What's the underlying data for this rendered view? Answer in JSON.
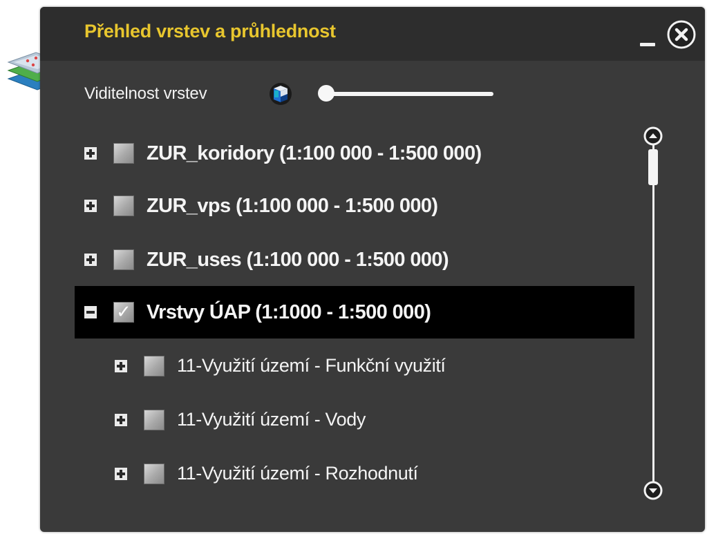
{
  "panel": {
    "title": "Přehled vrstev a průhlednost",
    "title_color": "#e8c62e",
    "minimize_icon": "minimize-icon",
    "close_icon": "close-icon"
  },
  "visibility": {
    "label": "Viditelnost vrstev",
    "opacity_icon": "opacity-cube-icon",
    "slider_value": 0
  },
  "tree": {
    "rows": [
      {
        "label": "ZUR_koridory (1:100 000 - 1:500 000)",
        "level": 0,
        "expanded": false,
        "checked": false,
        "selected": false
      },
      {
        "label": "ZUR_vps (1:100 000 - 1:500 000)",
        "level": 0,
        "expanded": false,
        "checked": false,
        "selected": false
      },
      {
        "label": "ZUR_uses (1:100 000 - 1:500 000)",
        "level": 0,
        "expanded": false,
        "checked": false,
        "selected": false
      },
      {
        "label": "Vrstvy ÚAP  (1:1000 - 1:500 000)",
        "level": 0,
        "expanded": true,
        "checked": true,
        "selected": true
      },
      {
        "label": "11-Využití území - Funkční využití",
        "level": 1,
        "expanded": false,
        "checked": false,
        "selected": false
      },
      {
        "label": "11-Využití území - Vody",
        "level": 1,
        "expanded": false,
        "checked": false,
        "selected": false
      },
      {
        "label": "11-Využití území - Rozhodnutí",
        "level": 1,
        "expanded": false,
        "checked": false,
        "selected": false
      }
    ]
  },
  "scrollbar": {
    "up_icon": "scroll-up-icon",
    "down_icon": "scroll-down-icon"
  }
}
